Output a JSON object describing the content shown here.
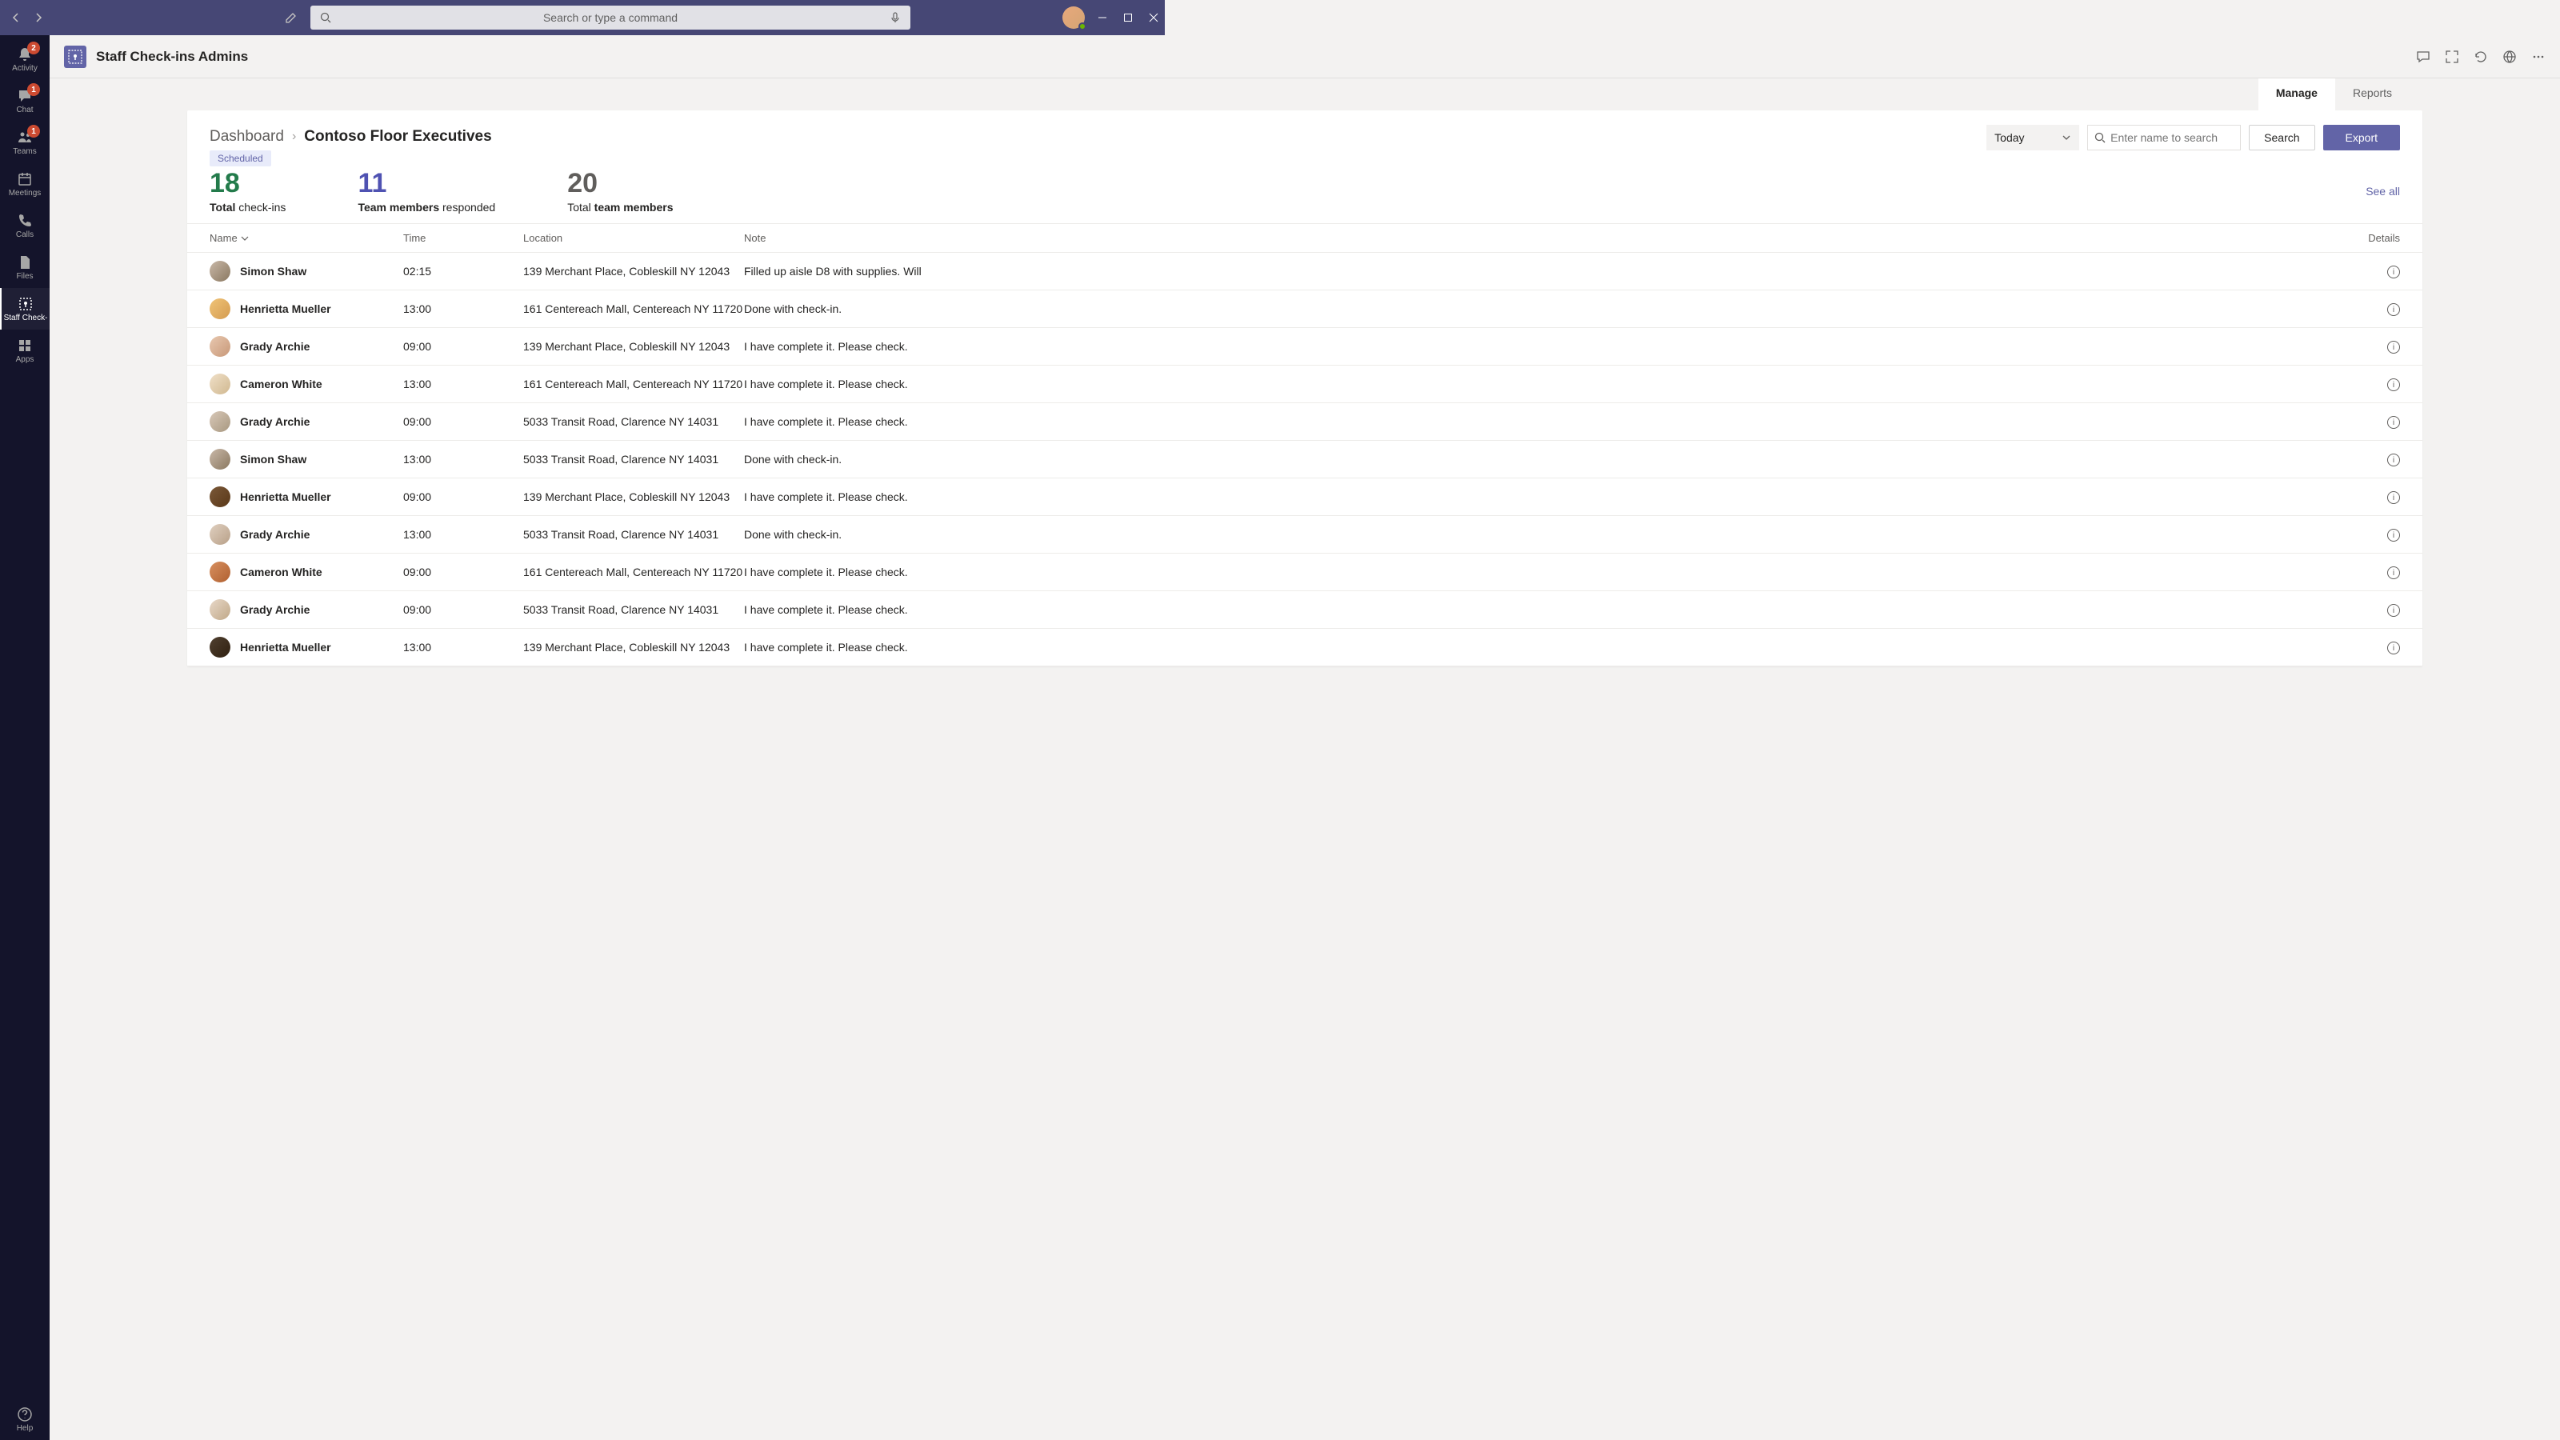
{
  "titlebar": {
    "search_placeholder": "Search or type a command"
  },
  "rail": {
    "items": [
      {
        "label": "Activity",
        "badge": "2"
      },
      {
        "label": "Chat",
        "badge": "1"
      },
      {
        "label": "Teams",
        "badge": "1"
      },
      {
        "label": "Meetings",
        "badge": ""
      },
      {
        "label": "Calls",
        "badge": ""
      },
      {
        "label": "Files",
        "badge": ""
      },
      {
        "label": "Staff Check-",
        "badge": ""
      },
      {
        "label": "Apps",
        "badge": ""
      }
    ],
    "help_label": "Help"
  },
  "header": {
    "title": "Staff Check-ins Admins"
  },
  "tabs": {
    "manage": "Manage",
    "reports": "Reports"
  },
  "breadcrumb": {
    "root": "Dashboard",
    "current": "Contoso Floor Executives"
  },
  "chip": "Scheduled",
  "toolbar": {
    "dropdown_value": "Today",
    "search_placeholder": "Enter name to search",
    "search_btn": "Search",
    "export_btn": "Export"
  },
  "stats": {
    "s1_num": "18",
    "s1_bold": "Total",
    "s1_rest": " check-ins",
    "s2_num": "11",
    "s2_bold": "Team members",
    "s2_rest": " responded",
    "s3_num": "20",
    "s3_pre": "Total ",
    "s3_bold": "team members",
    "see_all": "See all"
  },
  "columns": {
    "name": "Name",
    "time": "Time",
    "location": "Location",
    "note": "Note",
    "details": "Details"
  },
  "rows": [
    {
      "name": "Simon Shaw",
      "time": "02:15",
      "location": "139 Merchant Place, Cobleskill NY 12043",
      "note": "Filled up aisle D8 with supplies. Will",
      "av": "linear-gradient(135deg,#c9b8a8,#8a7860)"
    },
    {
      "name": "Henrietta Mueller",
      "time": "13:00",
      "location": "161 Centereach Mall, Centereach NY 11720",
      "note": "Done with check-in.",
      "av": "linear-gradient(135deg,#f0c478,#d49b50)"
    },
    {
      "name": "Grady Archie",
      "time": "09:00",
      "location": "139 Merchant Place, Cobleskill NY 12043",
      "note": "I have complete it. Please check.",
      "av": "linear-gradient(135deg,#e8c8b0,#c89878)"
    },
    {
      "name": "Cameron White",
      "time": "13:00",
      "location": "161 Centereach Mall, Centereach NY 11720",
      "note": "I have complete it. Please check.",
      "av": "linear-gradient(135deg,#f0e0c8,#d0b890)"
    },
    {
      "name": "Grady Archie",
      "time": "09:00",
      "location": "5033 Transit Road, Clarence NY 14031",
      "note": "I have complete it. Please check.",
      "av": "linear-gradient(135deg,#d8c8b8,#a89880)"
    },
    {
      "name": "Simon Shaw",
      "time": "13:00",
      "location": "5033 Transit Road, Clarence NY 14031",
      "note": "Done with check-in.",
      "av": "linear-gradient(135deg,#c9b8a8,#8a7860)"
    },
    {
      "name": "Henrietta Mueller",
      "time": "09:00",
      "location": "139 Merchant Place, Cobleskill NY 12043",
      "note": "I have complete it. Please check.",
      "av": "linear-gradient(135deg,#7a5838,#5a3818)"
    },
    {
      "name": "Grady Archie",
      "time": "13:00",
      "location": "5033 Transit Road, Clarence NY 14031",
      "note": "Done with check-in.",
      "av": "linear-gradient(135deg,#e0d0c0,#b8a088)"
    },
    {
      "name": "Cameron White",
      "time": "09:00",
      "location": "161 Centereach Mall, Centereach NY 11720",
      "note": "I have complete it. Please check.",
      "av": "linear-gradient(135deg,#d89060,#b06030)"
    },
    {
      "name": "Grady Archie",
      "time": "09:00",
      "location": "5033 Transit Road, Clarence NY 14031",
      "note": "I have complete it. Please check.",
      "av": "linear-gradient(135deg,#e8d8c8,#c0a888)"
    },
    {
      "name": "Henrietta Mueller",
      "time": "13:00",
      "location": "139 Merchant Place, Cobleskill NY 12043",
      "note": "I have complete it. Please check.",
      "av": "linear-gradient(135deg,#504030,#302010)"
    }
  ]
}
